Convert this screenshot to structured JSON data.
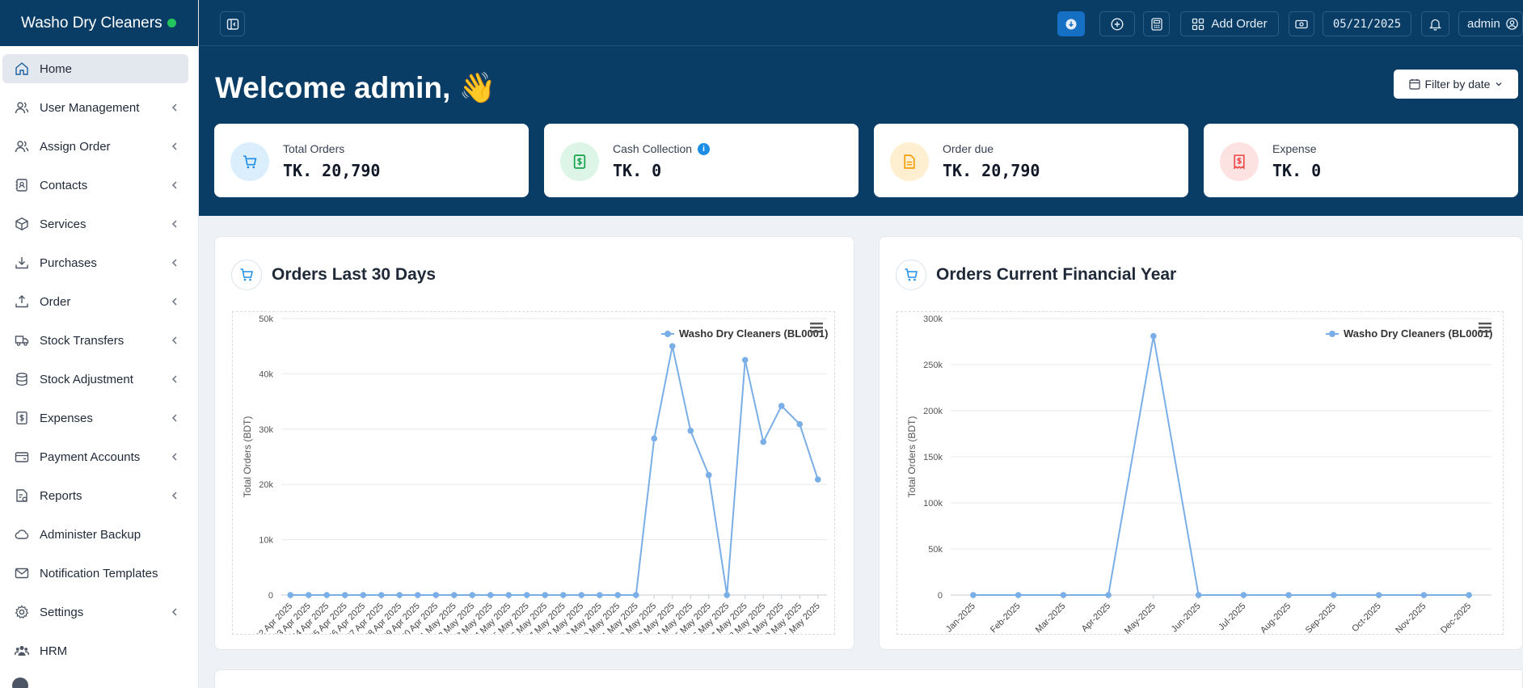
{
  "brand": {
    "name": "Washo Dry Cleaners",
    "status_color": "#22c55e"
  },
  "sidebar": {
    "items": [
      {
        "label": "Home",
        "icon": "home-icon",
        "active": true,
        "chevron": false
      },
      {
        "label": "User Management",
        "icon": "users-icon",
        "chevron": true
      },
      {
        "label": "Assign Order",
        "icon": "users-icon",
        "chevron": true
      },
      {
        "label": "Contacts",
        "icon": "contacts-icon",
        "chevron": true
      },
      {
        "label": "Services",
        "icon": "box-icon",
        "chevron": true
      },
      {
        "label": "Purchases",
        "icon": "download-icon",
        "chevron": true
      },
      {
        "label": "Order",
        "icon": "upload-icon",
        "chevron": true
      },
      {
        "label": "Stock Transfers",
        "icon": "truck-icon",
        "chevron": true
      },
      {
        "label": "Stock Adjustment",
        "icon": "database-icon",
        "chevron": true
      },
      {
        "label": "Expenses",
        "icon": "dollar-icon",
        "chevron": true
      },
      {
        "label": "Payment Accounts",
        "icon": "wallet-icon",
        "chevron": true
      },
      {
        "label": "Reports",
        "icon": "report-icon",
        "chevron": true
      },
      {
        "label": "Administer Backup",
        "icon": "cloud-icon",
        "chevron": false
      },
      {
        "label": "Notification Templates",
        "icon": "mail-icon",
        "chevron": false
      },
      {
        "label": "Settings",
        "icon": "gear-icon",
        "chevron": true
      },
      {
        "label": "HRM",
        "icon": "team-icon",
        "chevron": false
      }
    ]
  },
  "header": {
    "add_order_label": "Add Order",
    "date": "05/21/2025",
    "user": "admin"
  },
  "hero": {
    "welcome": "Welcome admin, 👋",
    "filter_label": "Filter by date"
  },
  "stats": [
    {
      "title": "Total Orders",
      "value": "TK. 20,790",
      "icon": "cart-icon",
      "bg": "#dbeefc",
      "fg": "#1d8ee6"
    },
    {
      "title": "Cash Collection",
      "value": "TK. 0",
      "icon": "cash-icon",
      "bg": "#dcf5e6",
      "fg": "#16a34a",
      "info": "i"
    },
    {
      "title": "Order due",
      "value": "TK. 20,790",
      "icon": "file-icon",
      "bg": "#fdefcf",
      "fg": "#f59e0b"
    },
    {
      "title": "Expense",
      "value": "TK. 0",
      "icon": "receipt-icon",
      "bg": "#fde2e2",
      "fg": "#ef4444"
    }
  ],
  "charts": {
    "left_title": "Orders Last 30 Days",
    "right_title": "Orders Current Financial Year"
  },
  "chart_data": [
    {
      "type": "line",
      "title": "",
      "ylabel": "Total Orders (BDT)",
      "xlabel": "",
      "ylim": [
        0,
        50000
      ],
      "yticks": [
        0,
        10000,
        20000,
        30000,
        40000,
        50000
      ],
      "ytick_labels": [
        "0",
        "10k",
        "20k",
        "30k",
        "40k",
        "50k"
      ],
      "grid": true,
      "legend": "top-right",
      "color": "#7aaee6",
      "categories": [
        "22 Apr 2025",
        "23 Apr 2025",
        "24 Apr 2025",
        "25 Apr 2025",
        "26 Apr 2025",
        "27 Apr 2025",
        "28 Apr 2025",
        "29 Apr 2025",
        "30 Apr 2025",
        "1 May 2025",
        "2 May 2025",
        "3 May 2025",
        "4 May 2025",
        "5 May 2025",
        "6 May 2025",
        "7 May 2025",
        "8 May 2025",
        "9 May 2025",
        "10 May 2025",
        "11 May 2025",
        "12 May 2025",
        "13 May 2025",
        "14 May 2025",
        "15 May 2025",
        "16 May 2025",
        "17 May 2025",
        "18 May 2025",
        "19 May 2025",
        "20 May 2025",
        "21 May 2025"
      ],
      "series": [
        {
          "name": "Washo Dry Cleaners (BL0001)",
          "values": [
            0,
            0,
            0,
            0,
            0,
            0,
            0,
            0,
            0,
            0,
            0,
            0,
            0,
            0,
            0,
            0,
            0,
            0,
            0,
            0,
            28300,
            45000,
            29700,
            21700,
            0,
            42500,
            27700,
            34200,
            30900,
            20900
          ]
        }
      ]
    },
    {
      "type": "line",
      "title": "",
      "ylabel": "Total Orders (BDT)",
      "xlabel": "",
      "ylim": [
        0,
        300000
      ],
      "yticks": [
        0,
        50000,
        100000,
        150000,
        200000,
        250000,
        300000
      ],
      "ytick_labels": [
        "0",
        "50k",
        "100k",
        "150k",
        "200k",
        "250k",
        "300k"
      ],
      "grid": true,
      "legend": "top-right",
      "color": "#7aaee6",
      "categories": [
        "Jan-2025",
        "Feb-2025",
        "Mar-2025",
        "Apr-2025",
        "May-2025",
        "Jun-2025",
        "Jul-2025",
        "Aug-2025",
        "Sep-2025",
        "Oct-2025",
        "Nov-2025",
        "Dec-2025"
      ],
      "series": [
        {
          "name": "Washo Dry Cleaners (BL0001)",
          "values": [
            0,
            0,
            0,
            0,
            281000,
            0,
            0,
            0,
            0,
            0,
            0,
            0
          ]
        }
      ]
    }
  ]
}
